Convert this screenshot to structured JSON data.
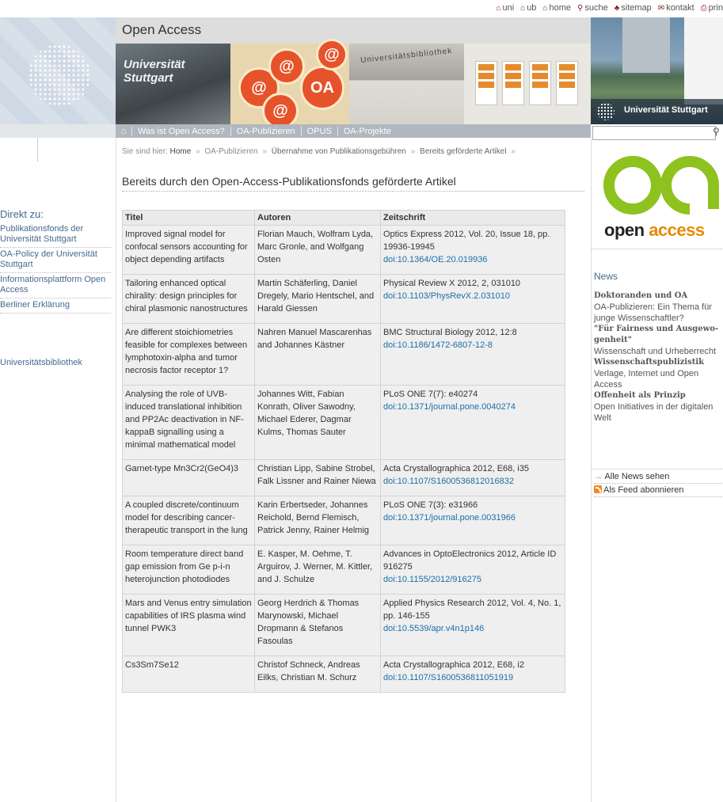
{
  "util": {
    "items": [
      {
        "icon": "home-icon",
        "label": "uni"
      },
      {
        "icon": "home-icon",
        "label": "ub"
      },
      {
        "icon": "home-icon",
        "label": "home"
      },
      {
        "icon": "search-icon",
        "label": "suche"
      },
      {
        "icon": "sitemap-icon",
        "label": "sitemap"
      },
      {
        "icon": "mail-icon",
        "label": "kontakt"
      },
      {
        "icon": "print-icon",
        "label": "prin"
      }
    ]
  },
  "header": {
    "title": "Open Access",
    "banner_text_1": "Universität Stuttgart",
    "banner_text_2": "Universitätsbibliothek",
    "university": "Universität Stuttgart",
    "badge_text": "OA"
  },
  "nav": {
    "items": [
      "Was ist Open Access?",
      "OA-Publizieren",
      "OPUS",
      "OA-Projekte"
    ]
  },
  "breadcrumb": {
    "prefix": "Sie sind hier:",
    "items": [
      "Home",
      "OA-Publizieren",
      "Übernahme von Publikationsgebühren",
      "Bereits geförderte Artikel"
    ]
  },
  "page_title": "Bereits durch den Open-Access-Publikationsfonds geförderte Artikel",
  "leftnav": {
    "heading": "Direkt zu:",
    "links": [
      "Publikationsfonds der Universität Stuttgart",
      "OA-Policy der Universität Stuttgart",
      "Informationsplattform Open Access",
      "Berliner Erklärung"
    ],
    "extra": "Universitätsbibliothek"
  },
  "table": {
    "headers": [
      "Titel",
      "Autoren",
      "Zeitschrift"
    ],
    "rows": [
      {
        "title": "Improved signal model for confocal sensors accounting for object depending artifacts",
        "authors": "Florian Mauch, Wolfram Lyda, Marc Gronle, and Wolfgang Osten",
        "journal": "Optics Express 2012, Vol. 20, Issue 18, pp. 19936-19945",
        "doi": "doi:10.1364/OE.20.019936"
      },
      {
        "title": "Tailoring enhanced optical chirality: design principles for chiral plasmonic nanostructures",
        "authors": "Martin Schäferling, Daniel Dregely, Mario Hentschel, and Harald Giessen",
        "journal": "Physical Review X 2012, 2, 031010",
        "doi": "doi:10.1103/PhysRevX.2.031010"
      },
      {
        "title": "Are different stoichiometries feasible for complexes between lymphotoxin-alpha and tumor necrosis factor receptor 1?",
        "authors": "Nahren Manuel Mascarenhas and Johannes Kästner",
        "journal": "BMC Structural Biology 2012, 12:8",
        "doi": "doi:10.1186/1472-6807-12-8"
      },
      {
        "title": "Analysing the role of UVB-induced translational inhibition and PP2Ac deactivation in NF-kappaB signalling using a minimal mathematical model",
        "authors": "Johannes Witt, Fabian Konrath, Oliver Sawodny, Michael Ederer, Dagmar Kulms, Thomas Sauter",
        "journal": "PLoS ONE 7(7): e40274",
        "doi": "doi:10.1371/journal.pone.0040274"
      },
      {
        "title": "Garnet-type Mn3Cr2(GeO4)3",
        "authors": "Christian Lipp, Sabine Strobel, Falk Lissner and Rainer Niewa",
        "journal": "Acta Crystallographica 2012, E68, i35",
        "doi": "doi:10.1107/S1600536812016832"
      },
      {
        "title": "A coupled discrete/continuum model for describing cancer-therapeutic transport in the lung",
        "authors": "Karin Erbertseder, Johannes Reichold, Bernd Flemisch, Patrick Jenny, Rainer Helmig",
        "journal": "PLoS ONE 7(3): e31966",
        "doi": "doi:10.1371/journal.pone.0031966"
      },
      {
        "title": "Room temperature direct band gap emission from Ge p-i-n heterojunction photodiodes",
        "authors": "E. Kasper, M. Oehme, T. Arguirov, J. Werner, M. Kittler, and J. Schulze",
        "journal": "Advances in OptoElectronics 2012, Article ID 916275",
        "doi": "doi:10.1155/2012/916275"
      },
      {
        "title": "Mars and Venus entry simulation capabilities of IRS plasma wind tunnel PWK3",
        "authors": "Georg Herdrich & Thomas Marynowski, Michael Dropmann & Stefanos Fasoulas",
        "journal": "Applied Physics Research 2012, Vol. 4, No. 1, pp. 146-155",
        "doi": "doi:10.5539/apr.v4n1p146"
      },
      {
        "title": "Cs3Sm7Se12",
        "authors": "Christof Schneck, Andreas Eilks, Christian M. Schurz",
        "journal": "Acta Crystallographica 2012, E68, i2",
        "doi": "doi:10.1107/S1600536811051919"
      }
    ]
  },
  "sidebar": {
    "logo_word_1": "open",
    "logo_word_2": "access",
    "news_heading": "News",
    "news": [
      {
        "text": "Doktoranden und OA",
        "bold": true
      },
      {
        "text": "OA-Publizieren: Ein Thema für junge Wissenschaftler?",
        "bold": false
      },
      {
        "text": "\"Für Fairness und Ausgewo-genheit\"",
        "bold": true
      },
      {
        "text": "Wissenschaft und Urheberrecht",
        "bold": false
      },
      {
        "text": "Wissenschaftspublizistik",
        "bold": true
      },
      {
        "text": "Verlage, Internet und Open Access",
        "bold": false
      },
      {
        "text": "Offenheit als Prinzip",
        "bold": true
      },
      {
        "text": "Open Initiatives in der digitalen Welt",
        "bold": false
      }
    ],
    "all_news": "Alle News sehen",
    "feed": "Als Feed abonnieren"
  },
  "colors": {
    "accent": "#1a6fa8",
    "oa_green": "#8dc21f",
    "oa_orange": "#e68a00",
    "nav_bg": "#b0b7bf"
  }
}
